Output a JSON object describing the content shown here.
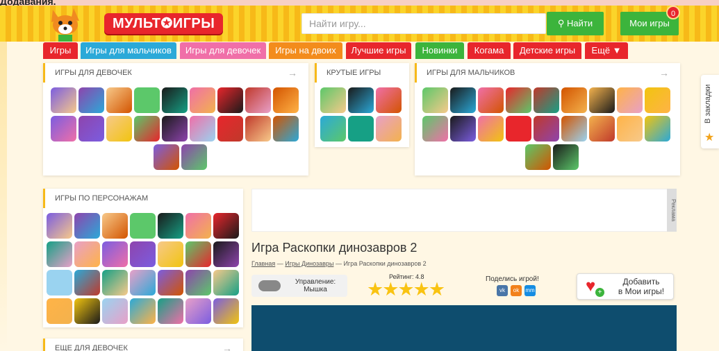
{
  "top_strip_text": "Додавания.",
  "header": {
    "brand": "МУЛЬТ✪ИГРЫ",
    "search_placeholder": "Найти игру...",
    "search_button": "Найти",
    "my_games": "Мои игры",
    "my_games_count": "0"
  },
  "nav": [
    {
      "label": "Игры",
      "color": "#e8262c"
    },
    {
      "label": "Игры для мальчиков",
      "color": "#2ba9d8"
    },
    {
      "label": "Игры для девочек",
      "color": "#f06fa8"
    },
    {
      "label": "Игры на двоих",
      "color": "#f38c1c"
    },
    {
      "label": "Лучшие игры",
      "color": "#e8262c"
    },
    {
      "label": "Новинки",
      "color": "#3cb43c"
    },
    {
      "label": "Когама",
      "color": "#e8262c"
    },
    {
      "label": "Детские игры",
      "color": "#e8262c"
    },
    {
      "label": "Ещё ▼",
      "color": "#e8262c"
    }
  ],
  "panels": {
    "girls": {
      "title": "Игры для девочек",
      "arrow": "→"
    },
    "cool": {
      "title": "Крутые игры"
    },
    "boys": {
      "title": "Игры для мальчиков",
      "arrow": "→"
    },
    "characters": {
      "title": "Игры по персонажам"
    },
    "more_girls": {
      "title": "Еще для девочек",
      "arrow": "→"
    }
  },
  "bookmark": {
    "label": "В закладки",
    "icon": "star-icon"
  },
  "ad_label": "Реклама",
  "game": {
    "title": "Игра Раскопки динозавров 2",
    "breadcrumb_home": "Главная",
    "breadcrumb_cat": "Игры Динозавры",
    "breadcrumb_sep": "—",
    "breadcrumb_current": "Игра Раскопки динозавров 2",
    "control_label": "Управление:",
    "control_value": "Мышка",
    "rating_label": "Рейтинг: 4.8",
    "stars": "★★★★★",
    "share_label": "Поделись игрой!",
    "share_vk": "vk",
    "share_ok": "ok",
    "share_mm": "mm",
    "add_line1": "Добавить",
    "add_line2": "в Мои игры!"
  }
}
